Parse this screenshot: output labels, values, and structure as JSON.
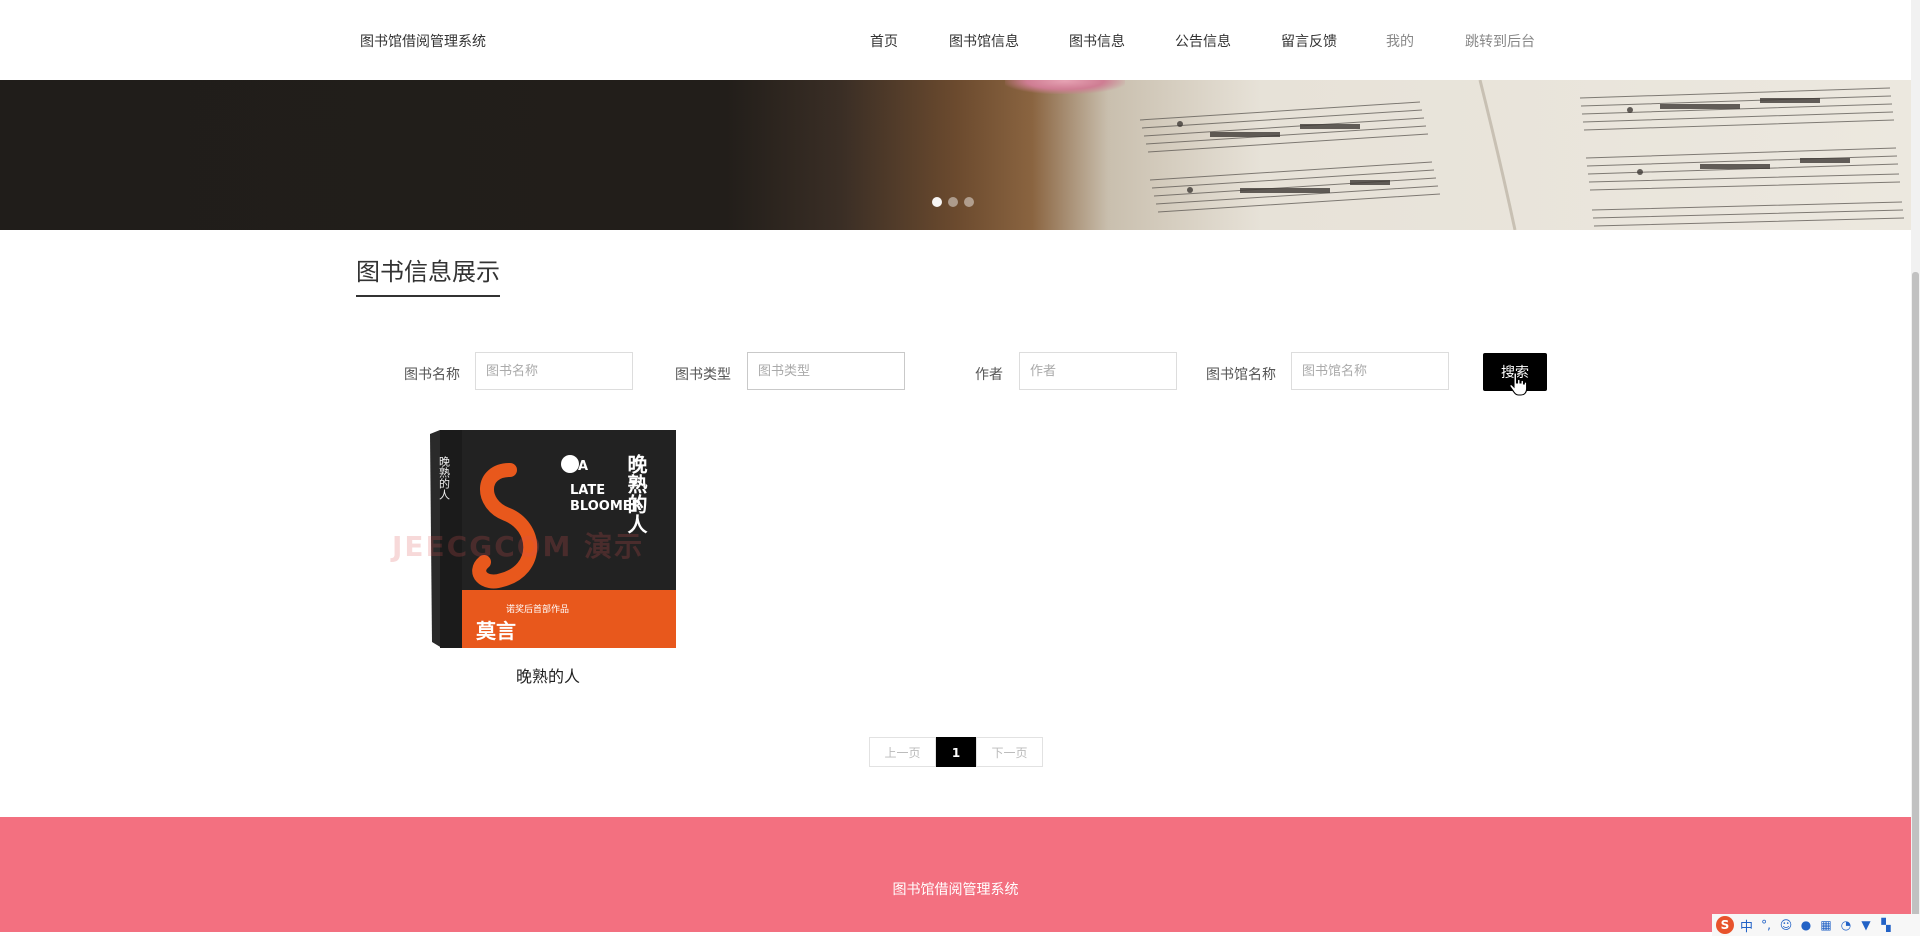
{
  "header": {
    "brand": "图书馆借阅管理系统",
    "nav": [
      {
        "label": "首页"
      },
      {
        "label": "图书馆信息"
      },
      {
        "label": "图书信息"
      },
      {
        "label": "公告信息"
      },
      {
        "label": "留言反馈"
      },
      {
        "label": "我的"
      },
      {
        "label": "跳转到后台"
      }
    ]
  },
  "banner": {
    "slide_count": 3,
    "active_slide": 1
  },
  "section": {
    "title": "图书信息展示"
  },
  "search": {
    "fields": [
      {
        "label": "图书名称",
        "placeholder": "图书名称",
        "value": ""
      },
      {
        "label": "图书类型",
        "placeholder": "图书类型",
        "value": ""
      },
      {
        "label": "作者",
        "placeholder": "作者",
        "value": ""
      },
      {
        "label": "图书馆名称",
        "placeholder": "图书馆名称",
        "value": ""
      }
    ],
    "button_label": "搜索"
  },
  "books": [
    {
      "title": "晚熟的人",
      "cover": {
        "title_cn": "晚熟的人",
        "title_en_lines": [
          "A",
          "LATE",
          "BLOOMER"
        ],
        "author": "莫言",
        "spine_title": "晚熟的人",
        "tagline": "诺奖后首部作品",
        "background_color": "#e8581c",
        "top_color": "#222222"
      },
      "watermark": "JEECGCOM 演示"
    }
  ],
  "pagination": {
    "prev_label": "上一页",
    "current": "1",
    "next_label": "下一页"
  },
  "footer": {
    "text": "图书馆借阅管理系统"
  },
  "ime": {
    "mode": "中",
    "icons": [
      "sogou-icon",
      "punctuation-icon",
      "emoji-icon",
      "mic-icon",
      "keyboard-icon",
      "user-icon",
      "shirt-icon",
      "grid-icon"
    ]
  }
}
